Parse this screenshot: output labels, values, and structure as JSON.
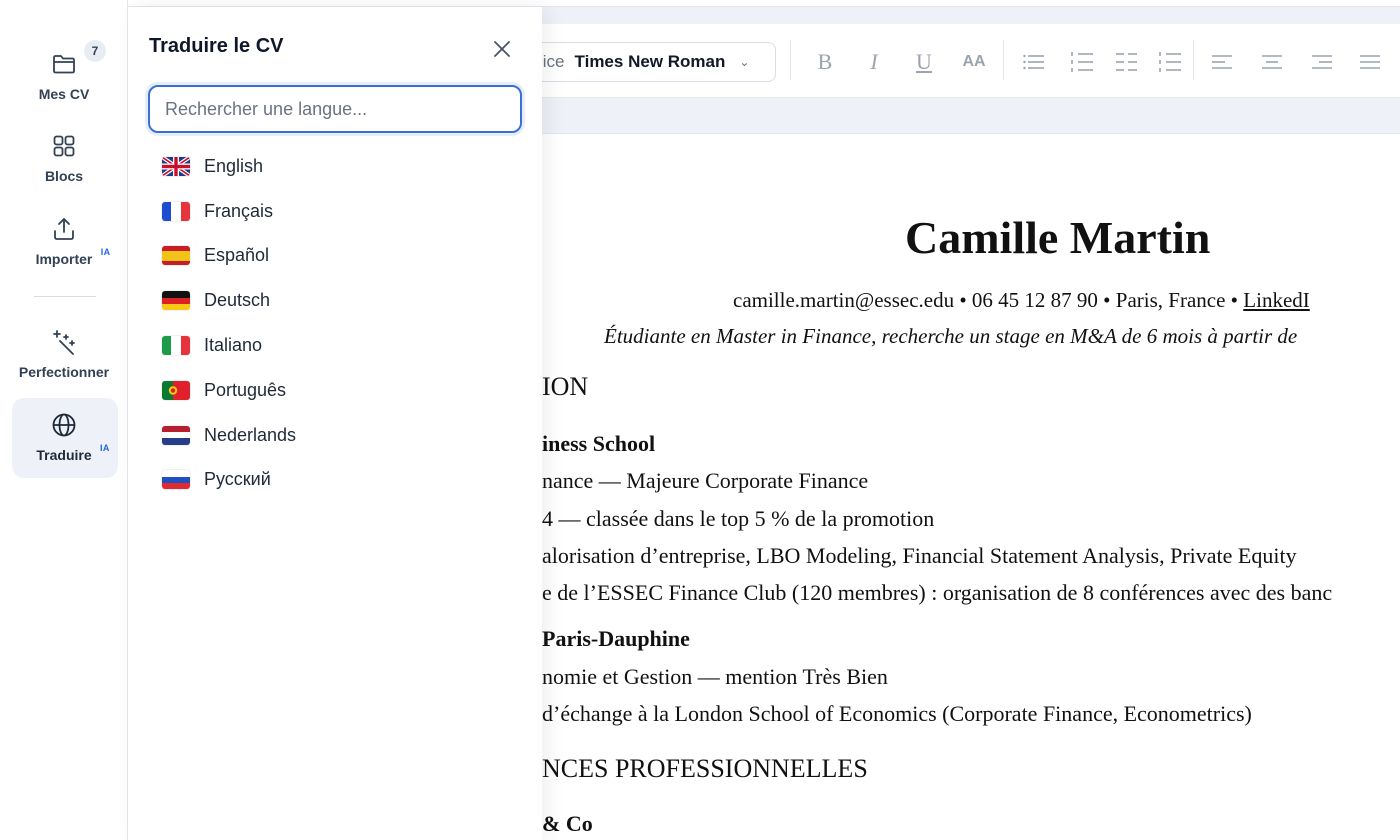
{
  "rail": {
    "items": [
      {
        "label": "Mes CV",
        "badge": "7"
      },
      {
        "label": "Blocs"
      },
      {
        "label": "Importer",
        "tag": "IA"
      },
      {
        "label": "Perfectionner"
      },
      {
        "label": "Traduire",
        "tag": "IA",
        "active": true
      }
    ]
  },
  "panel": {
    "title": "Traduire le CV",
    "search_placeholder": "Rechercher une langue...",
    "languages": [
      "English",
      "Français",
      "Español",
      "Deutsch",
      "Italiano",
      "Português",
      "Nederlands",
      "Русский"
    ]
  },
  "toolbar": {
    "font_prefix": "lice",
    "font_value": "Times New Roman",
    "bold": "B",
    "italic": "I",
    "underline": "U",
    "case": "AA"
  },
  "document": {
    "name": "Camille Martin",
    "contact_text": "camille.martin@essec.edu • 06 45 12 87 90 • Paris, France • ",
    "contact_link": "LinkedI",
    "objective": "Étudiante en Master in Finance, recherche un stage en M&A de 6 mois à partir de",
    "lines": [
      "ION",
      "iness School",
      "nance — Majeure Corporate Finance",
      "4 — classée dans le top 5 % de la promotion",
      "alorisation d’entreprise, LBO Modeling, Financial Statement Analysis, Private Equity",
      "e de l’ESSEC Finance Club (120 membres) : organisation de 8 conférences avec des banc",
      "Paris-Dauphine",
      "nomie et Gestion — mention Très Bien",
      "d’échange à la London School of Economics (Corporate Finance, Econometrics)",
      "NCES PROFESSIONNELLES",
      "& Co"
    ]
  }
}
